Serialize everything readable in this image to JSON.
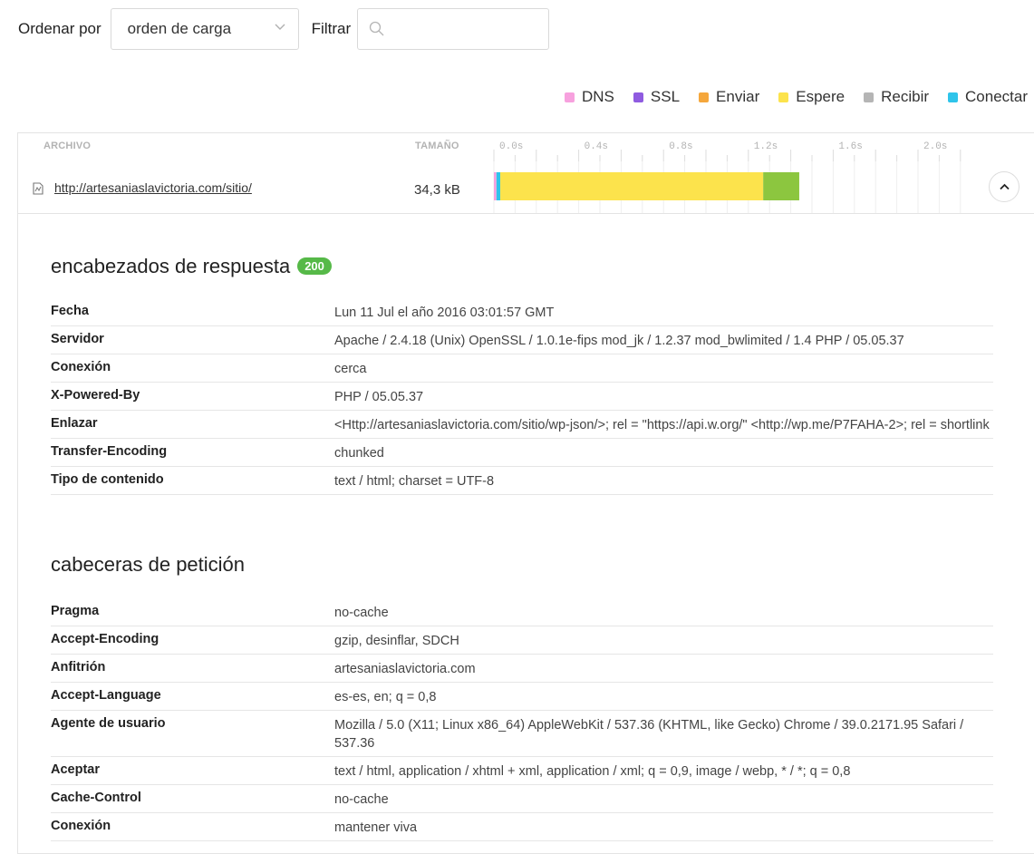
{
  "toolbar": {
    "sort_label": "Ordenar por",
    "sort_value": "orden de carga",
    "filter_label": "Filtrar",
    "filter_value": "",
    "filter_placeholder": ""
  },
  "legend": [
    {
      "label": "DNS",
      "color": "#f7a1de"
    },
    {
      "label": "SSL",
      "color": "#8f5be0"
    },
    {
      "label": "Enviar",
      "color": "#f5a73c"
    },
    {
      "label": "Espere",
      "color": "#fce34c"
    },
    {
      "label": "Recibir",
      "color": "#b5b5b5"
    },
    {
      "label": "Conectar",
      "color": "#2fc4ea"
    }
  ],
  "table": {
    "headers": {
      "file": "ARCHIVO",
      "size": "TAMAÑO"
    },
    "ticks": [
      "0.0s",
      "0.4s",
      "0.8s",
      "1.2s",
      "1.6s",
      "2.0s"
    ],
    "rows": [
      {
        "url": "http://artesaniaslavictoria.com/sitio/",
        "size": "34,3 kB",
        "timing": [
          {
            "phase": "DNS",
            "seconds": 0.012,
            "color": "#f7a1de"
          },
          {
            "phase": "Conectar",
            "seconds": 0.018,
            "color": "#2fc4ea"
          },
          {
            "phase": "Espere",
            "seconds": 1.24,
            "color": "#fce34c"
          },
          {
            "phase": "Recibir",
            "seconds": 0.17,
            "color": "#8cc63f"
          }
        ]
      }
    ]
  },
  "response": {
    "title": "encabezados de respuesta",
    "status": "200",
    "headers": [
      {
        "key": "Fecha",
        "value": "Lun 11 Jul el año 2016 03:01:57 GMT"
      },
      {
        "key": "Servidor",
        "value": "Apache / 2.4.18 (Unix) OpenSSL / 1.0.1e-fips mod_jk / 1.2.37 mod_bwlimited / 1.4 PHP / 05.05.37"
      },
      {
        "key": "Conexión",
        "value": "cerca"
      },
      {
        "key": "X-Powered-By",
        "value": "PHP / 05.05.37"
      },
      {
        "key": "Enlazar",
        "value": "<Http://artesaniaslavictoria.com/sitio/wp-json/>; rel = \"https://api.w.org/\" <http://wp.me/P7FAHA-2>; rel = shortlink"
      },
      {
        "key": "Transfer-Encoding",
        "value": "chunked"
      },
      {
        "key": "Tipo de contenido",
        "value": "text / html; charset = UTF-8"
      }
    ]
  },
  "request": {
    "title": "cabeceras de petición",
    "headers": [
      {
        "key": "Pragma",
        "value": "no-cache"
      },
      {
        "key": "Accept-Encoding",
        "value": "gzip, desinflar, SDCH"
      },
      {
        "key": "Anfitrión",
        "value": "artesaniaslavictoria.com"
      },
      {
        "key": "Accept-Language",
        "value": "es-es, en; q = 0,8"
      },
      {
        "key": "Agente de usuario",
        "value": "Mozilla / 5.0 (X11; Linux x86_64) AppleWebKit / 537.36 (KHTML, like Gecko) Chrome / 39.0.2171.95 Safari / 537.36"
      },
      {
        "key": "Aceptar",
        "value": "text / html, application / xhtml + xml, application / xml; q = 0,9, image / webp, * / *; q = 0,8"
      },
      {
        "key": "Cache-Control",
        "value": "no-cache"
      },
      {
        "key": "Conexión",
        "value": "mantener viva"
      }
    ]
  }
}
